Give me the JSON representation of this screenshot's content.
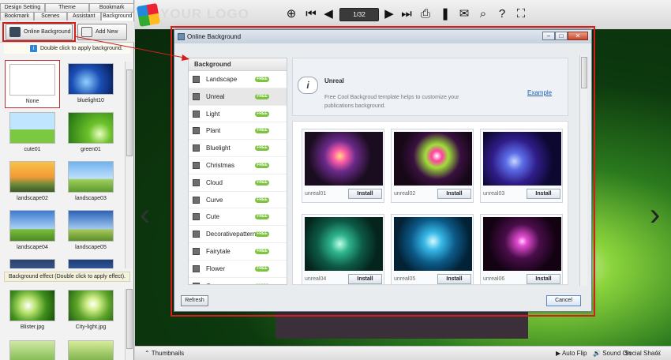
{
  "left_panel": {
    "tabs_row1": [
      "Design Setting",
      "Theme",
      "Bookmark"
    ],
    "tabs_row2": [
      "Bookmark Tabs",
      "Scenes",
      "Assistant",
      "Background"
    ],
    "online_background_button": "Online Background",
    "add_new_button": "Add New",
    "hint": "Double click to apply background.",
    "backgrounds": [
      "None",
      "bluelight10",
      "cute01",
      "green01",
      "landscape02",
      "landscape03",
      "landscape04",
      "landscape05"
    ],
    "effect_label": "Background effect (Double click to apply effect).",
    "effects": [
      "Blister.jpg",
      "City-light.jpg"
    ]
  },
  "toolbar": {
    "logo_text": "YOUR LOGO",
    "page_indicator": "1/32"
  },
  "bottom_bar": {
    "thumbnails": "Thumbnails",
    "auto_flip": "Auto Flip",
    "sound_on": "Sound On",
    "social_share": "Social Share"
  },
  "dialog": {
    "title": "Online Background",
    "category_header": "Background",
    "free_badge": "FREE",
    "categories": [
      "Landscape",
      "Unreal",
      "Light",
      "Plant",
      "Bluelight",
      "Christmas",
      "Cloud",
      "Curve",
      "Cute",
      "Decorativepattern",
      "Fairytale",
      "Flower",
      "Green"
    ],
    "selected_category": "Unreal",
    "info": {
      "title": "Unreal",
      "description": "Free Cool Backgroud template helps to customize your publications background.",
      "example_link": "Example"
    },
    "templates": [
      "unreal01",
      "unreal02",
      "unreal03",
      "unreal04",
      "unreal05",
      "unreal06"
    ],
    "install_label": "Install",
    "refresh_button": "Refresh",
    "cancel_button": "Cancel"
  },
  "colors": {
    "highlight_red": "#d31e1e",
    "free_green": "#7cc43f",
    "link_blue": "#1f5fb0"
  }
}
